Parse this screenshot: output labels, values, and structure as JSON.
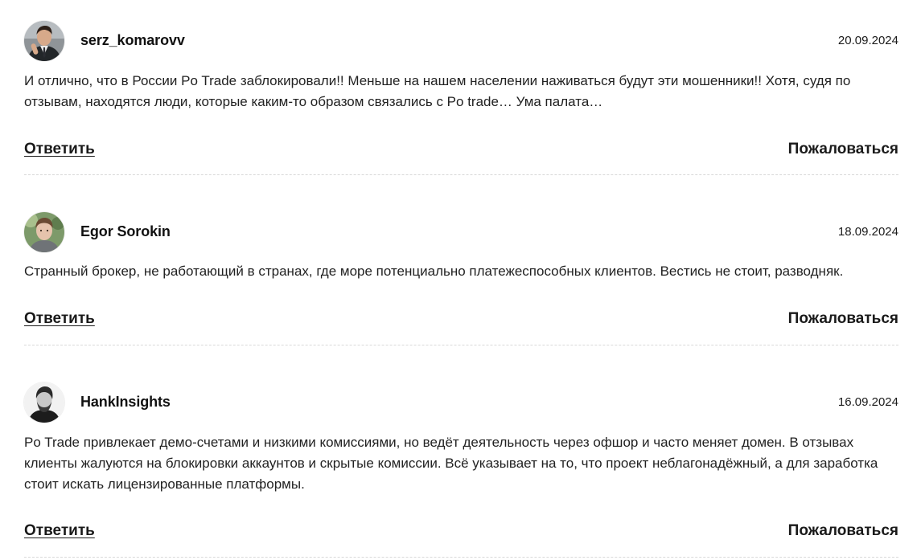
{
  "comments": [
    {
      "author": "serz_komarovv",
      "date": "20.09.2024",
      "text": "И отлично, что в России Po Trade заблокировали!! Меньше на нашем населении наживаться будут эти мошенники!! Хотя, судя по отзывам, находятся люди, которые каким-то образом связались с Po trade… Ума палата…",
      "avatar": "man-in-suit-avatar",
      "reply_label": "Ответить",
      "report_label": "Пожаловаться"
    },
    {
      "author": "Egor Sorokin",
      "date": "18.09.2024",
      "text": "Странный брокер, не работающий в странах, где море потенциально платежеспособных клиентов. Вестись не стоит, разводняк.",
      "avatar": "young-man-avatar",
      "reply_label": "Ответить",
      "report_label": "Пожаловаться"
    },
    {
      "author": "HankInsights",
      "date": "16.09.2024",
      "text": "Po Trade привлекает демо-счетами и низкими комиссиями, но ведёт деятельность через офшор и часто меняет домен. В отзывах клиенты жалуются на блокировки аккаунтов и скрытые комиссии. Всё указывает на то, что проект неблагонадёжный, а для заработка стоит искать лицензированные платформы.",
      "avatar": "bw-bearded-man-avatar",
      "reply_label": "Ответить",
      "report_label": "Пожаловаться"
    }
  ]
}
